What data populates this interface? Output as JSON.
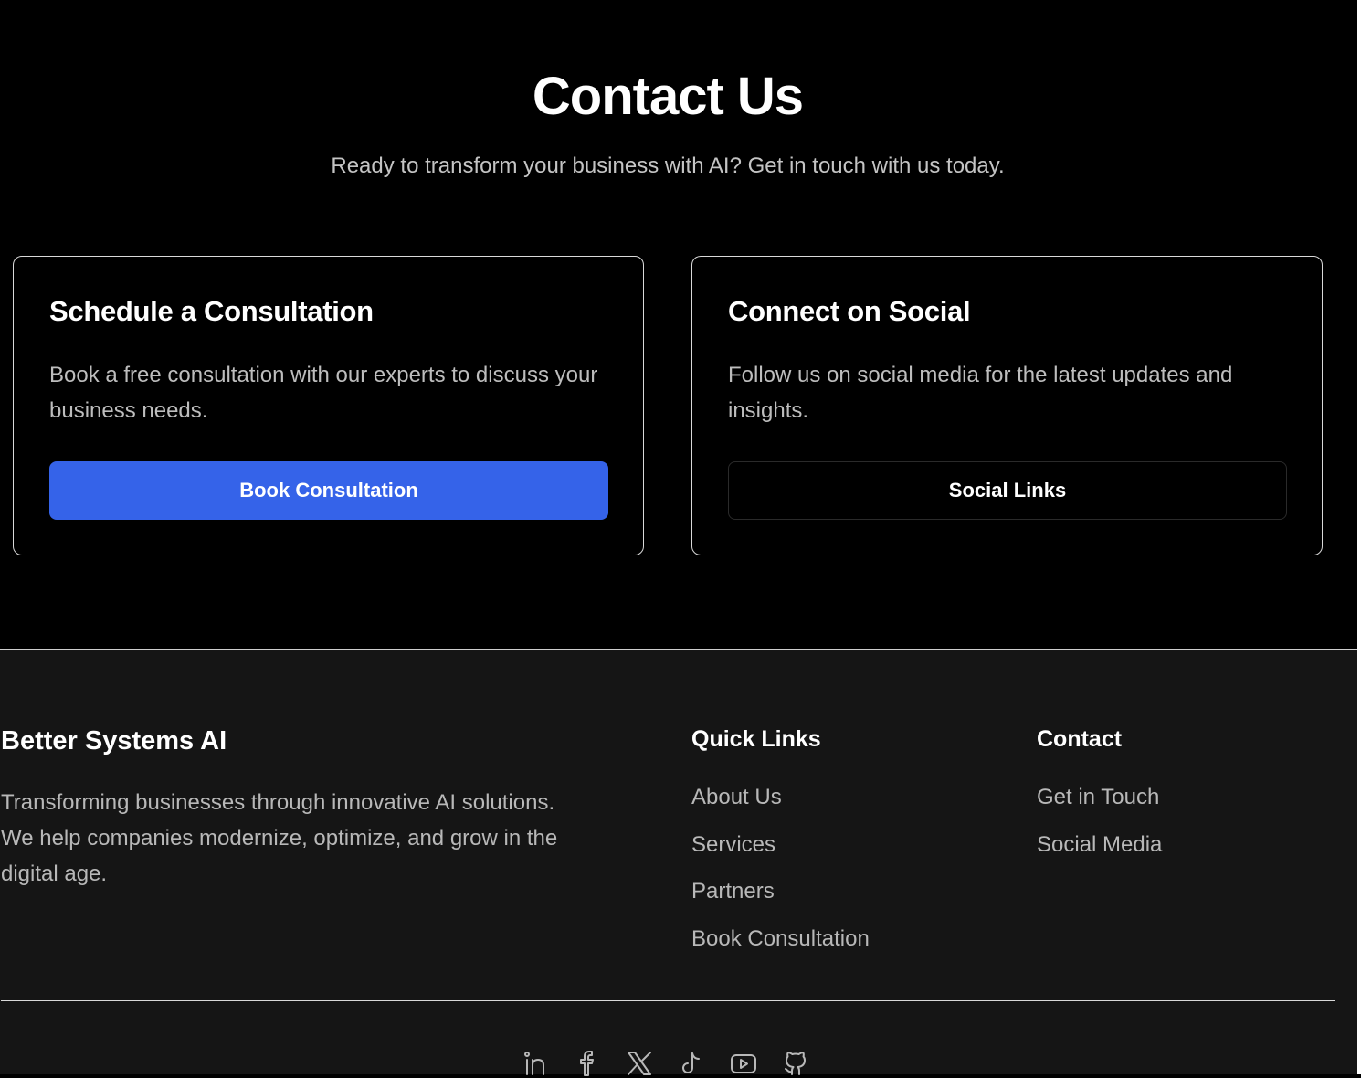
{
  "contact": {
    "title": "Contact Us",
    "subtitle": "Ready to transform your business with AI? Get in touch with us today."
  },
  "cards": {
    "consultation": {
      "title": "Schedule a Consultation",
      "description": "Book a free consultation with our experts to discuss your business needs.",
      "button_label": "Book Consultation",
      "button_color": "#3563e9"
    },
    "social": {
      "title": "Connect on Social",
      "description": "Follow us on social media for the latest updates and insights.",
      "button_label": "Social Links"
    }
  },
  "footer": {
    "brand": {
      "name": "Better Systems AI",
      "description": "Transforming businesses through innovative AI solutions. We help companies modernize, optimize, and grow in the digital age."
    },
    "quick_links": {
      "title": "Quick Links",
      "items": [
        "About Us",
        "Services",
        "Partners",
        "Book Consultation"
      ]
    },
    "contact": {
      "title": "Contact",
      "items": [
        "Get in Touch",
        "Social Media"
      ]
    },
    "social_icons": [
      "linkedin-icon",
      "facebook-icon",
      "x-icon",
      "tiktok-icon",
      "youtube-icon",
      "github-icon"
    ]
  }
}
